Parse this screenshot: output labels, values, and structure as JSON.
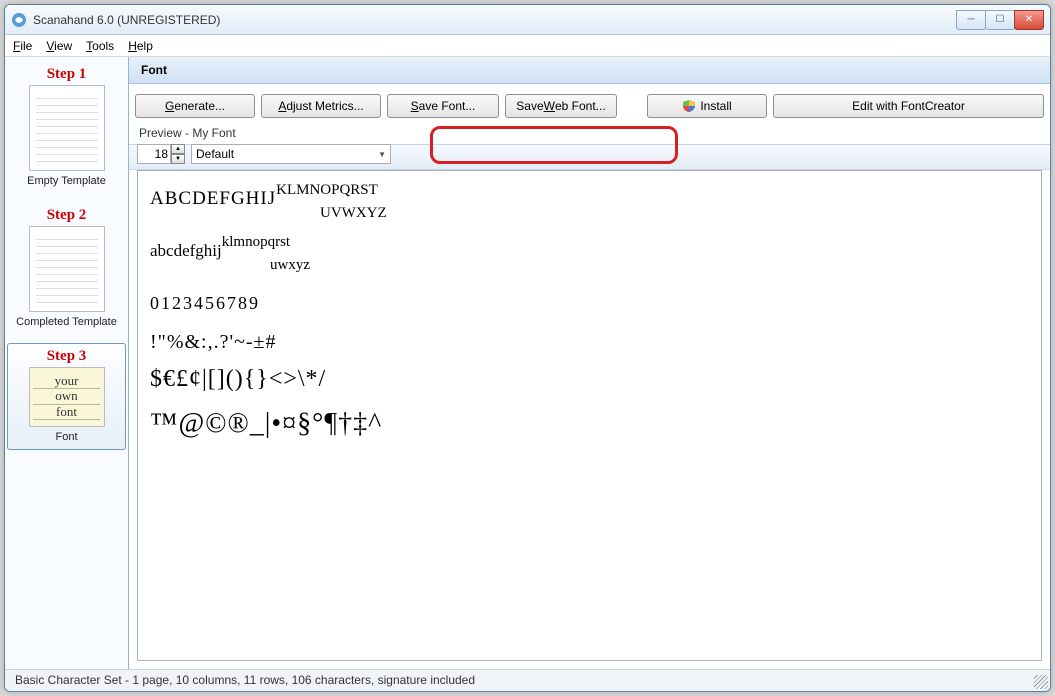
{
  "window": {
    "title": "Scanahand 6.0 (UNREGISTERED)"
  },
  "menu": {
    "file": "File",
    "view": "View",
    "tools": "Tools",
    "help": "Help"
  },
  "sidebar": {
    "step1": {
      "title": "Step 1",
      "label": "Empty Template"
    },
    "step2": {
      "title": "Step 2",
      "label": "Completed Template"
    },
    "step3": {
      "title": "Step 3",
      "label": "Font",
      "thumb_l1": "your",
      "thumb_l2": "own",
      "thumb_l3": "font"
    }
  },
  "page": {
    "title": "Font"
  },
  "toolbar": {
    "generate": "Generate...",
    "adjust": "Adjust Metrics...",
    "savefont": "Save Font...",
    "savewebfont": "Save Web Font...",
    "install": "Install",
    "editfc": "Edit with FontCreator"
  },
  "preview": {
    "label": "Preview - My Font",
    "size": "18",
    "combo": "Default",
    "upper1": "ABCDEFGHIJ",
    "upper2": "KLMNOPQRST",
    "upper3": "UVWXYZ",
    "lower1": "abcdefghij",
    "lower2": "klmnopqrst",
    "lower3": "uwxyz",
    "nums": "0123456789",
    "sym1": "!\"%&:,.?'~-±#",
    "sym2": "$€£¢|[](){}<>\\*/",
    "sym3": "™@©®_|•¤§°¶†‡^"
  },
  "status": {
    "text": "Basic Character Set - 1 page, 10 columns, 11 rows, 106 characters, signature included"
  }
}
